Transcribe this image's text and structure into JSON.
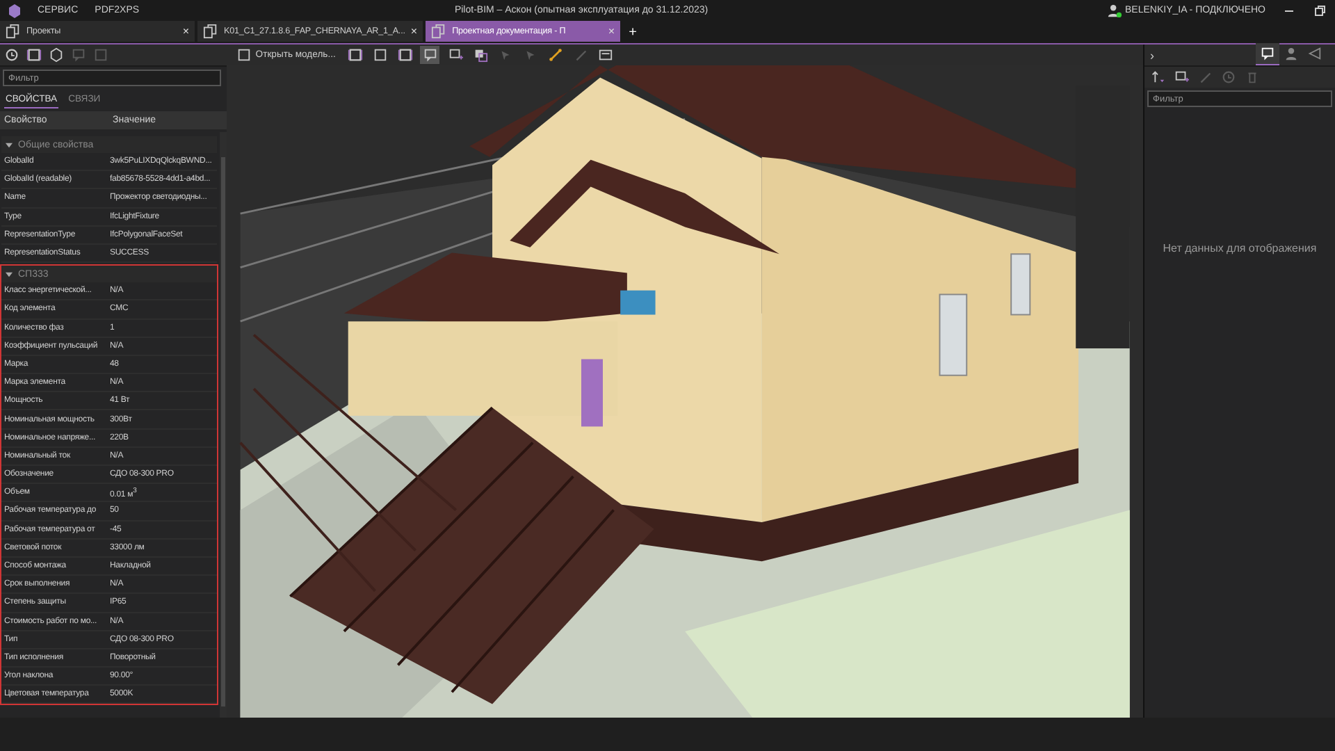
{
  "menu_bar": {
    "items": [
      "СЕРВИС",
      "PDF2XPS"
    ],
    "title": "Pilot-BIM – Аскон (опытная эксплуатация до 31.12.2023)",
    "user": "BELENKIY_IA - ПОДКЛЮЧЕНО"
  },
  "tabs": [
    {
      "label": "Проекты",
      "selected": false,
      "close": "×"
    },
    {
      "label": "K01_C1_27.1.8.6_FAP_CHERNAYA_AR_1_A...",
      "selected": false,
      "close": "×"
    },
    {
      "label": "Проектная документация - П",
      "selected": true,
      "close": "×"
    }
  ],
  "new_tab": "+",
  "left_toolbar": [
    {
      "disabled": false
    },
    {
      "disabled": false
    },
    {
      "disabled": false
    },
    {
      "disabled": true
    },
    {
      "disabled": true
    }
  ],
  "left_panel": {
    "filter": {
      "placeholder": "Фильтр"
    },
    "tabs": [
      {
        "label": "СВОЙСТВА",
        "selected": true
      },
      {
        "label": "СВЯЗИ",
        "selected": false
      }
    ],
    "columns": [
      "Свойство",
      "Значение"
    ],
    "groups": [
      {
        "title": "Общие свойства",
        "expanded": true,
        "highlighted": false,
        "rows": [
          [
            "GlobalId",
            "3wk5PuLIXDqQlckqBWND..."
          ],
          [
            "GlobalId (readable)",
            "fab85678-5528-4dd1-a4bd..."
          ],
          [
            "Name",
            "Прожектор светодиодны..."
          ],
          [
            "Type",
            "IfcLightFixture"
          ],
          [
            "RepresentationType",
            "IfcPolygonalFaceSet"
          ],
          [
            "RepresentationStatus",
            "SUCCESS"
          ]
        ]
      },
      {
        "title": "СП333",
        "expanded": true,
        "highlighted": true,
        "rows": [
          [
            "Класс энергетической...",
            "N/A"
          ],
          [
            "Код элемента",
            "CMC"
          ],
          [
            "Количество фаз",
            "1"
          ],
          [
            "Коэффициент пульсаций",
            "N/A"
          ],
          [
            "Марка",
            "48"
          ],
          [
            "Марка элемента",
            "N/A"
          ],
          [
            "Мощность",
            "41 Вт"
          ],
          [
            "Номинальная мощность",
            "300Вт"
          ],
          [
            "Номинальное напряже...",
            "220В"
          ],
          [
            "Номинальный ток",
            "N/A"
          ],
          [
            "Обозначение",
            "СДО 08-300 PRO"
          ],
          [
            "Объем",
            "0.01 м$^{3}$"
          ],
          [
            "Рабочая температура до",
            "50"
          ],
          [
            "Рабочая температура от",
            "-45"
          ],
          [
            "Световой поток",
            "33000 лм"
          ],
          [
            "Способ монтажа",
            "Накладной"
          ],
          [
            "Срок выполнения",
            "N/A"
          ],
          [
            "Степень защиты",
            "IP65"
          ],
          [
            "Стоимость работ по мо...",
            "N/A"
          ],
          [
            "Тип",
            "СДО 08-300 PRO"
          ],
          [
            "Тип исполнения",
            "Поворотный"
          ],
          [
            "Угол наклона",
            "90.00°"
          ],
          [
            "Цветовая температура",
            "5000K"
          ]
        ]
      }
    ]
  },
  "viewport_toolbar": {
    "open_button": "Открыть модель...",
    "tools": [
      {
        "active": false,
        "disabled": false
      },
      {
        "active": false,
        "disabled": false
      },
      {
        "active": false,
        "disabled": false
      },
      {
        "active": true,
        "disabled": false
      },
      {
        "active": false,
        "disabled": false
      },
      {
        "active": false,
        "disabled": false
      },
      {
        "active": false,
        "disabled": true
      },
      {
        "active": false,
        "disabled": true
      },
      {
        "active": false,
        "disabled": false
      },
      {
        "active": false,
        "disabled": true
      },
      {
        "active": false,
        "disabled": false
      }
    ]
  },
  "right_panel": {
    "expand": "›",
    "tabs": [
      {
        "selected": true
      },
      {
        "selected": false
      },
      {
        "selected": false
      }
    ],
    "tools": [
      {
        "disabled": false
      },
      {
        "disabled": false
      },
      {
        "disabled": true
      },
      {
        "disabled": true
      },
      {
        "disabled": true
      }
    ],
    "filter": {
      "placeholder": "Фильтр"
    },
    "empty_message": "Нет данных для отображения"
  }
}
